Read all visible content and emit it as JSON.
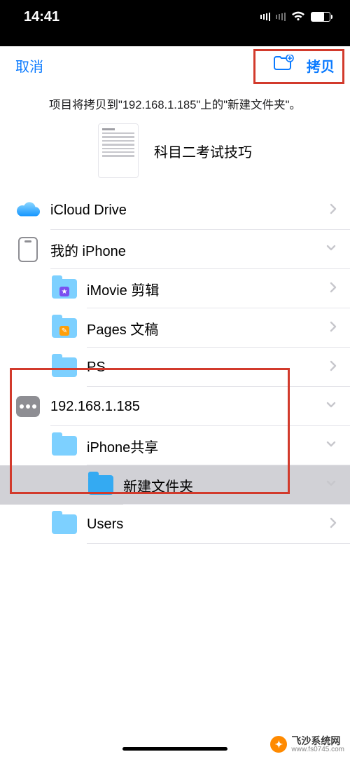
{
  "status": {
    "time": "14:41"
  },
  "nav": {
    "cancel": "取消",
    "copy": "拷贝"
  },
  "subtitle": "项目将拷贝到\"192.168.1.185\"上的\"新建文件夹\"。",
  "document": {
    "title": "科目二考试技巧"
  },
  "rows": [
    {
      "label": "iCloud Drive",
      "icon": "icloud",
      "indent": 0,
      "chevron": "right"
    },
    {
      "label": "我的 iPhone",
      "icon": "iphone",
      "indent": 0,
      "chevron": "down"
    },
    {
      "label": "iMovie 剪辑",
      "icon": "folder-star",
      "indent": 1,
      "chevron": "right"
    },
    {
      "label": "Pages 文稿",
      "icon": "folder-pen",
      "indent": 1,
      "chevron": "right"
    },
    {
      "label": "PS",
      "icon": "folder",
      "indent": 1,
      "chevron": "right"
    },
    {
      "label": "192.168.1.185",
      "icon": "server",
      "indent": 0,
      "chevron": "down"
    },
    {
      "label": "iPhone共享",
      "icon": "folder",
      "indent": 1,
      "chevron": "down"
    },
    {
      "label": "新建文件夹",
      "icon": "folder-solid",
      "indent": 2,
      "chevron": "down",
      "selected": true
    },
    {
      "label": "Users",
      "icon": "folder",
      "indent": 1,
      "chevron": "right"
    }
  ],
  "watermark": {
    "brand": "飞沙系统网",
    "url": "www.fs0745.com"
  }
}
